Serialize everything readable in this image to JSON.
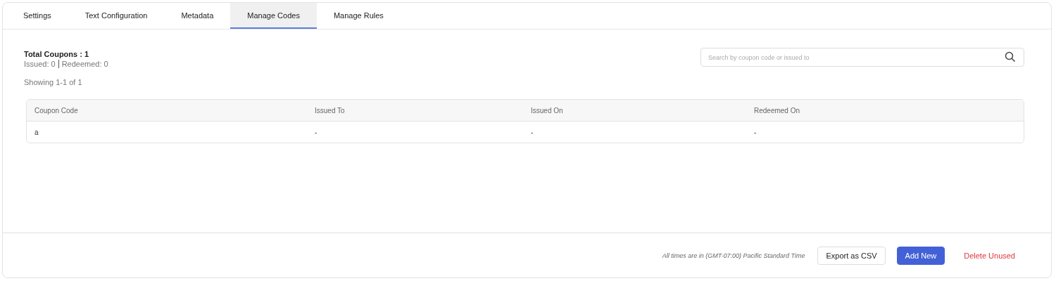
{
  "tabs": [
    {
      "label": "Settings",
      "selected": false
    },
    {
      "label": "Text Configuration",
      "selected": false
    },
    {
      "label": "Metadata",
      "selected": false
    },
    {
      "label": "Manage Codes",
      "selected": true
    },
    {
      "label": "Manage Rules",
      "selected": false
    }
  ],
  "summary": {
    "total": "Total Coupons : 1",
    "issued": "Issued: 0",
    "redeemed": "Redeemed: 0",
    "showing": "Showing 1-1 of 1"
  },
  "search": {
    "placeholder": "Search by coupon code or issued to"
  },
  "table": {
    "columns": [
      "Coupon Code",
      "Issued To",
      "Issued On",
      "Redeemed On"
    ],
    "rows": [
      [
        "a",
        "-",
        "-",
        "-"
      ]
    ]
  },
  "footer": {
    "timezone_note": "All times are in (GMT-07:00) Pacific Standard Time",
    "buttons": [
      {
        "label": "Export as CSV",
        "kind": "outline"
      },
      {
        "label": "Add New",
        "kind": "primary"
      },
      {
        "label": "Delete Unused",
        "kind": "danger"
      }
    ]
  }
}
